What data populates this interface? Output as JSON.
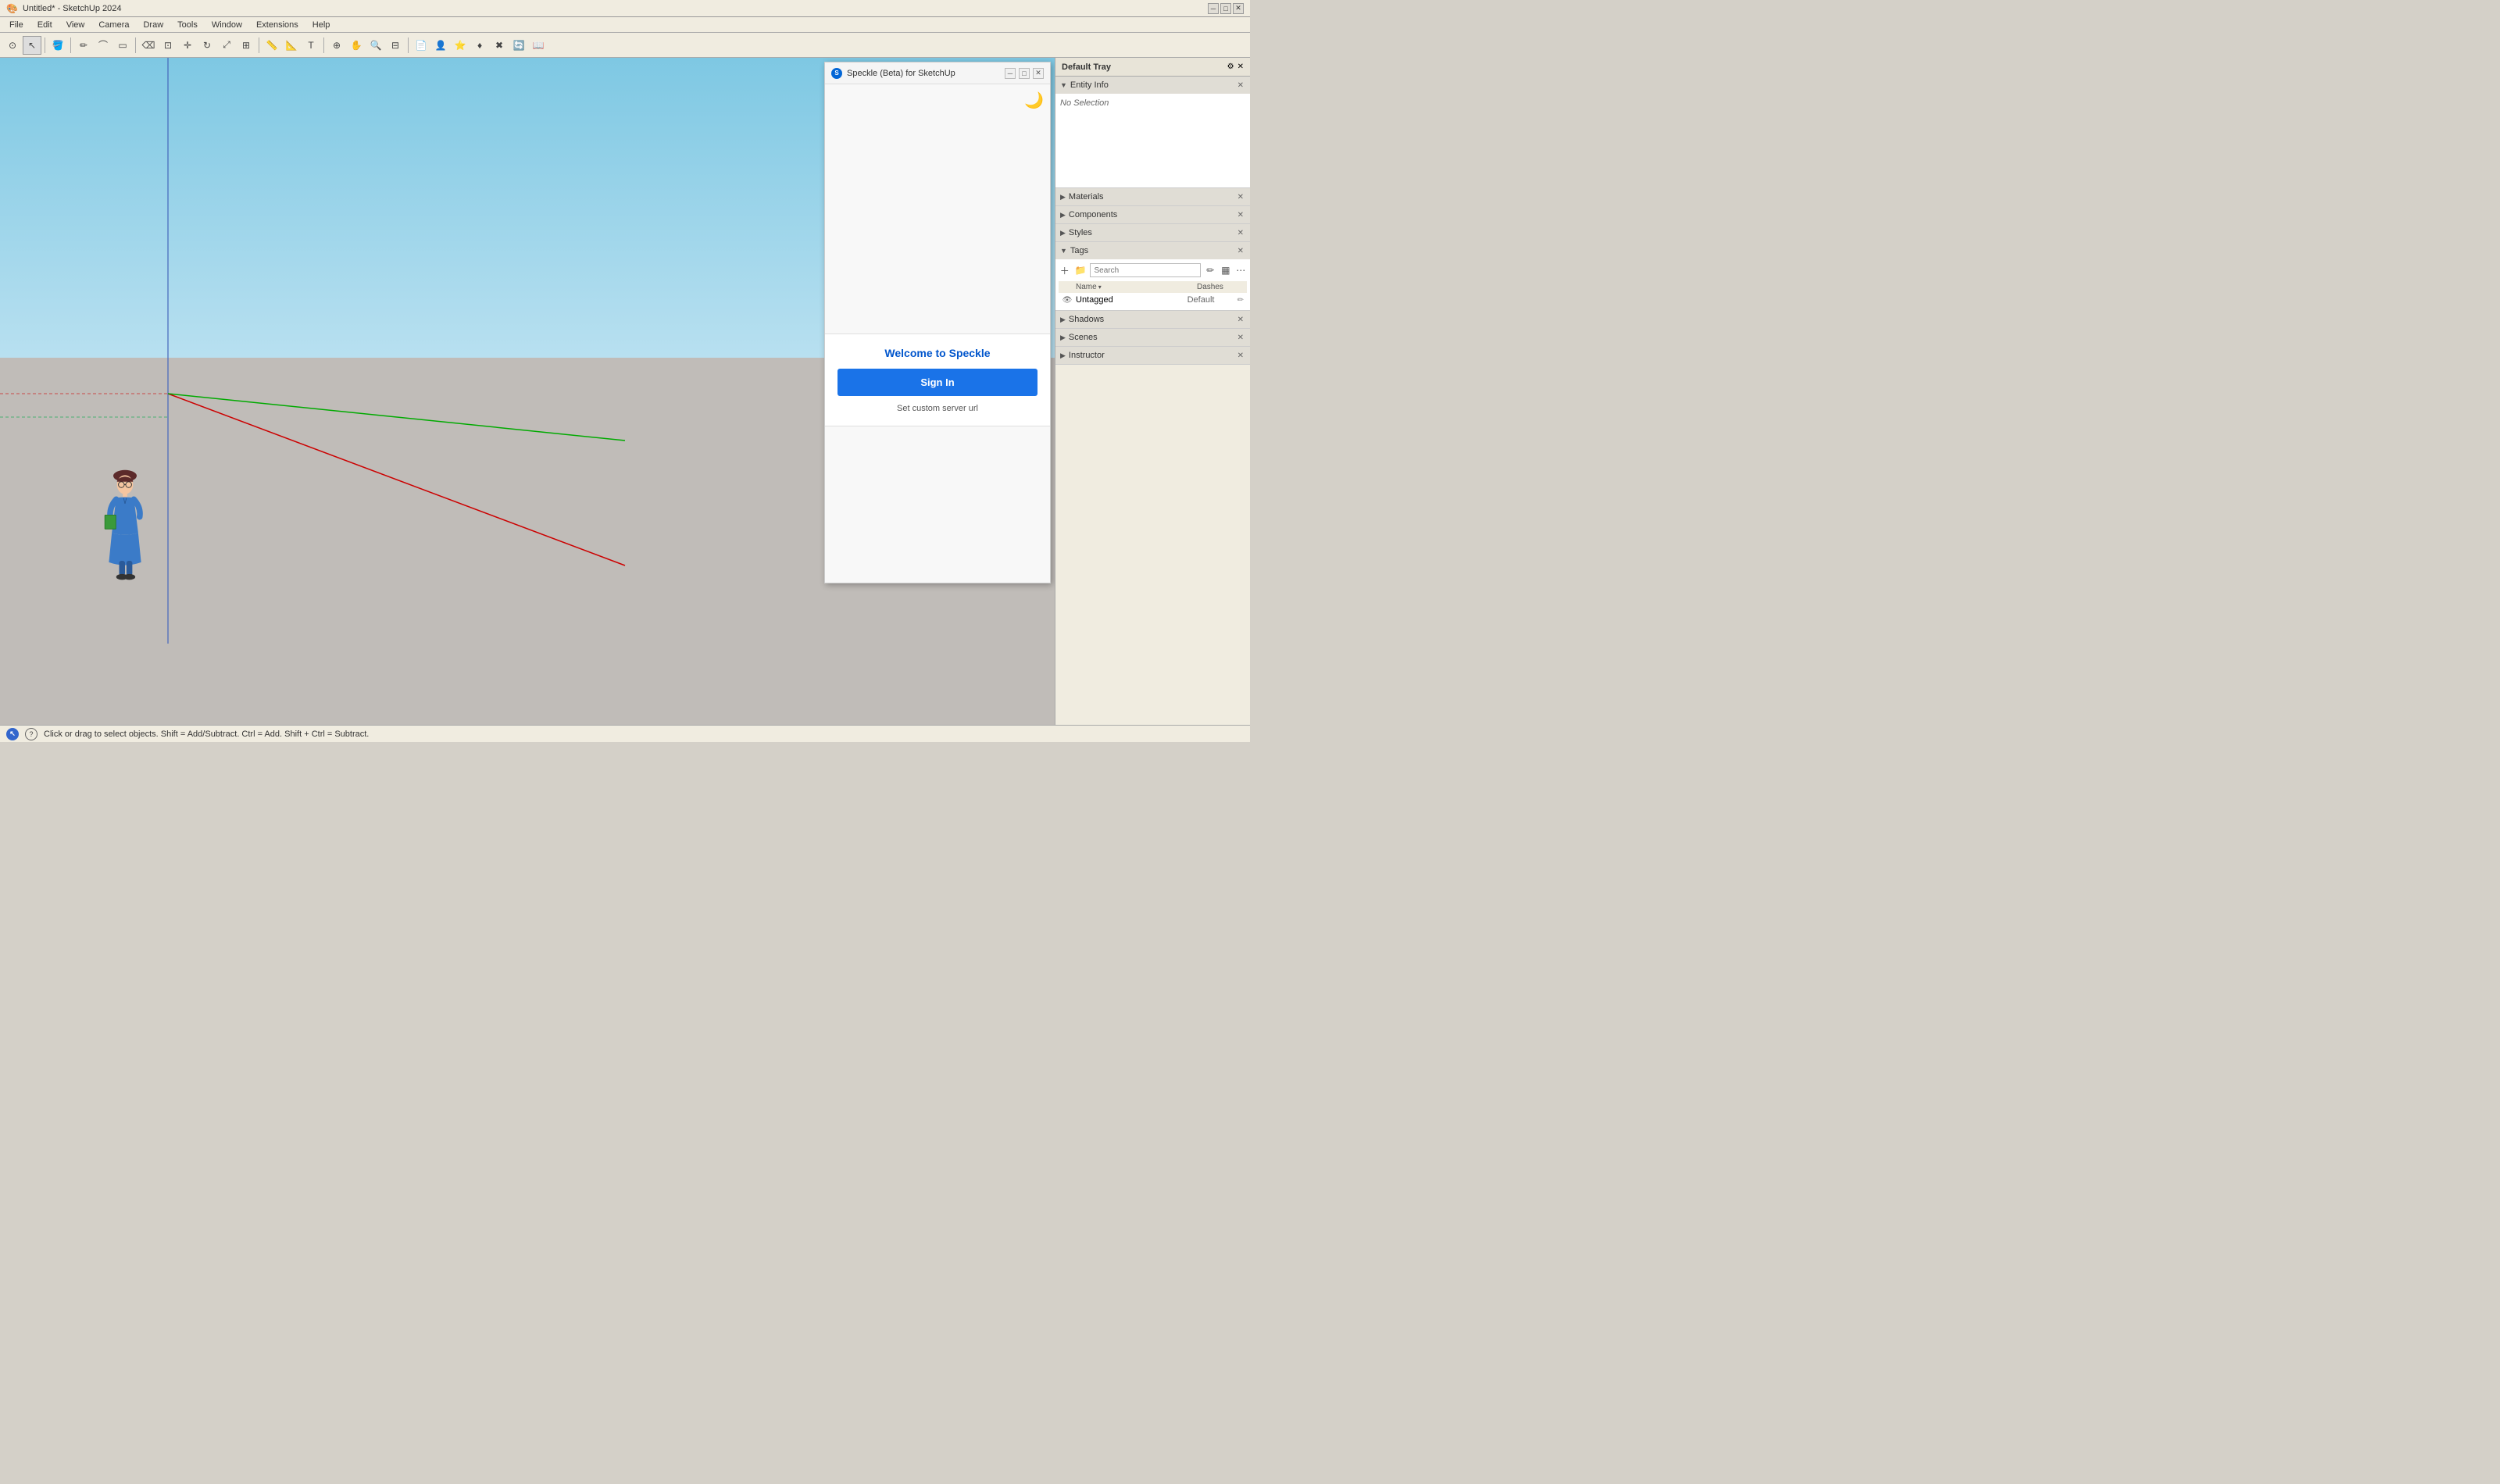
{
  "titlebar": {
    "title": "Untitled* - SketchUp 2024",
    "minimize": "─",
    "maximize": "□",
    "close": "✕"
  },
  "menubar": {
    "items": [
      "File",
      "Edit",
      "View",
      "Camera",
      "Draw",
      "Tools",
      "Window",
      "Extensions",
      "Help"
    ]
  },
  "toolbar": {
    "buttons": [
      {
        "name": "search-tool",
        "icon": "⊙",
        "tooltip": "Search"
      },
      {
        "name": "select-tool",
        "icon": "↖",
        "tooltip": "Select"
      },
      {
        "name": "paint-bucket",
        "icon": "🪣",
        "tooltip": "Paint Bucket"
      },
      {
        "name": "pencil",
        "icon": "✏",
        "tooltip": "Pencil"
      },
      {
        "name": "arc1",
        "icon": "⌒",
        "tooltip": "Arc"
      },
      {
        "name": "shape",
        "icon": "□",
        "tooltip": "Shape"
      },
      {
        "name": "push-pull",
        "icon": "⊡",
        "tooltip": "Push/Pull"
      },
      {
        "name": "move",
        "icon": "✛",
        "tooltip": "Move"
      },
      {
        "name": "rotate",
        "icon": "↻",
        "tooltip": "Rotate"
      },
      {
        "name": "offset",
        "icon": "⊞",
        "tooltip": "Offset"
      },
      {
        "name": "tape",
        "icon": "📏",
        "tooltip": "Tape Measure"
      },
      {
        "name": "orbit",
        "icon": "⊕",
        "tooltip": "Orbit"
      },
      {
        "name": "pan",
        "icon": "✋",
        "tooltip": "Pan"
      },
      {
        "name": "zoom",
        "icon": "⊘",
        "tooltip": "Zoom"
      },
      {
        "name": "zoom-extents",
        "icon": "⊟",
        "tooltip": "Zoom Extents"
      },
      {
        "name": "components",
        "icon": "⊞",
        "tooltip": "Components"
      },
      {
        "name": "follow-me",
        "icon": "⊳",
        "tooltip": "Follow Me"
      },
      {
        "name": "intersect",
        "icon": "✖",
        "tooltip": "Intersect"
      }
    ]
  },
  "speckle_dialog": {
    "title": "Speckle (Beta) for SketchUp",
    "welcome_title": "Welcome to Speckle",
    "signin_label": "Sign In",
    "custom_server_label": "Set custom server url",
    "loading_icon": "🌙"
  },
  "right_panel": {
    "title": "Default Tray",
    "sections": [
      {
        "id": "entity-info",
        "title": "Entity Info",
        "expanded": true,
        "content": "No Selection"
      },
      {
        "id": "materials",
        "title": "Materials",
        "expanded": false
      },
      {
        "id": "components",
        "title": "Components",
        "expanded": false
      },
      {
        "id": "styles",
        "title": "Styles",
        "expanded": false
      },
      {
        "id": "tags",
        "title": "Tags",
        "expanded": true,
        "search_placeholder": "Search",
        "columns": [
          "Name",
          "Dashes"
        ],
        "rows": [
          {
            "name": "Untagged",
            "dashes": "Default",
            "visible": true
          }
        ]
      },
      {
        "id": "shadows",
        "title": "Shadows",
        "expanded": false
      },
      {
        "id": "scenes",
        "title": "Scenes",
        "expanded": false
      },
      {
        "id": "instructor",
        "title": "Instructor",
        "expanded": false
      }
    ]
  },
  "status_bar": {
    "text": "Click or drag to select objects. Shift = Add/Subtract. Ctrl = Add. Shift + Ctrl = Subtract."
  }
}
